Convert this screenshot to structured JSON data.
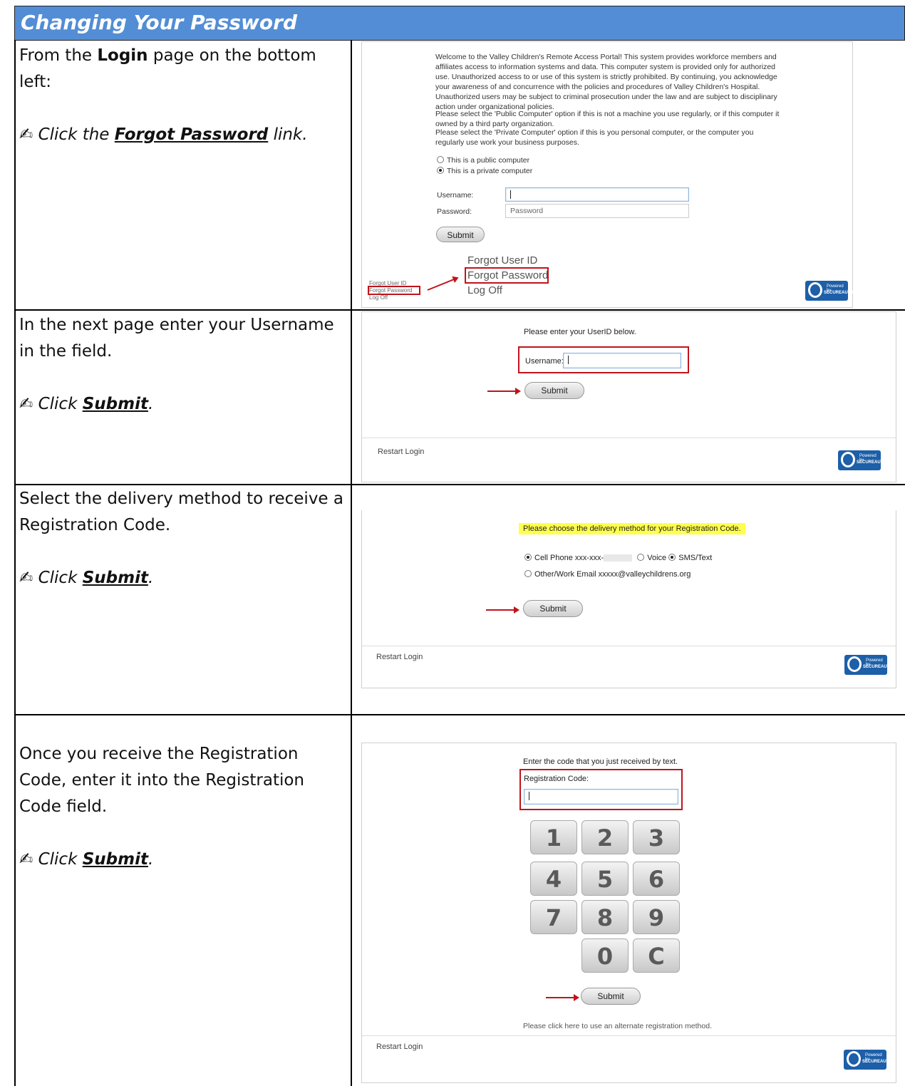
{
  "header": {
    "title": "Changing Your Password"
  },
  "steps": [
    {
      "p1_pre": "From the ",
      "p1_bold": "Login",
      "p1_post": " page on the bottom left:",
      "instr_pre": "Click the ",
      "instr_link": "Forgot Password",
      "instr_post": " link."
    },
    {
      "p1": "In the next page enter your Username in the field.",
      "instr_pre": "Click ",
      "instr_link": "Submit",
      "instr_post": "."
    },
    {
      "p1": "Select the delivery method to receive a Registration Code.",
      "instr_pre": "Click ",
      "instr_link": "Submit",
      "instr_post": "."
    },
    {
      "p1": "Once you receive the Registration Code, enter it into the Registration Code field.",
      "instr_pre": "Click ",
      "instr_link": "Submit",
      "instr_post": "."
    }
  ],
  "login_screen": {
    "welcome": "Welcome to the Valley Children's Remote Access Portal! This system provides workforce members and affiliates access to information systems and data. This computer system is provided only for authorized use. Unauthorized access to or use of this system is strictly prohibited. By continuing, you acknowledge your awareness of and concurrence with the policies and procedures of Valley Children's Hospital. Unauthorized users may be subject to criminal prosecution under the law and are subject to disciplinary action under organizational policies.",
    "public_note": "Please select the 'Public Computer' option if this is not a machine you use regularly, or if this computer it owned by a third party organization.",
    "private_note": "Please select the 'Private Computer' option if this is you personal computer, or the computer you regularly use work your business purposes.",
    "radio_public": "This is a public computer",
    "radio_private": "This is a private computer",
    "username_label": "Username:",
    "password_label": "Password:",
    "password_placeholder": "Password",
    "submit": "Submit",
    "zoom_links": [
      "Forgot User ID",
      "Forgot Password",
      "Log Off"
    ],
    "small_links": [
      "Forgot User ID",
      "Forgot Password",
      "Log Off"
    ]
  },
  "userid_screen": {
    "prompt": "Please enter your UserID below.",
    "username_label": "Username:",
    "submit": "Submit",
    "restart": "Restart Login"
  },
  "delivery_screen": {
    "prompt": "Please choose the delivery method for your Registration Code.",
    "cell_label": "Cell Phone xxx-xxx-",
    "voice": "Voice",
    "sms": "SMS/Text",
    "email_label": "Other/Work Email xxxxx@valleychildrens.org",
    "submit": "Submit",
    "restart": "Restart Login"
  },
  "code_screen": {
    "prompt": "Enter the code that you just received by text.",
    "code_label": "Registration Code:",
    "keys": [
      "1",
      "2",
      "3",
      "4",
      "5",
      "6",
      "7",
      "8",
      "9",
      "0",
      "C"
    ],
    "submit": "Submit",
    "alternate": "Please click here to use an alternate registration method.",
    "restart": "Restart Login"
  },
  "logo": {
    "line1": "Powered by",
    "line2": "SECUREAUTH"
  },
  "colors": {
    "header_bg": "#538dd5",
    "highlight": "#ffff4d",
    "callout": "#c0141c"
  }
}
